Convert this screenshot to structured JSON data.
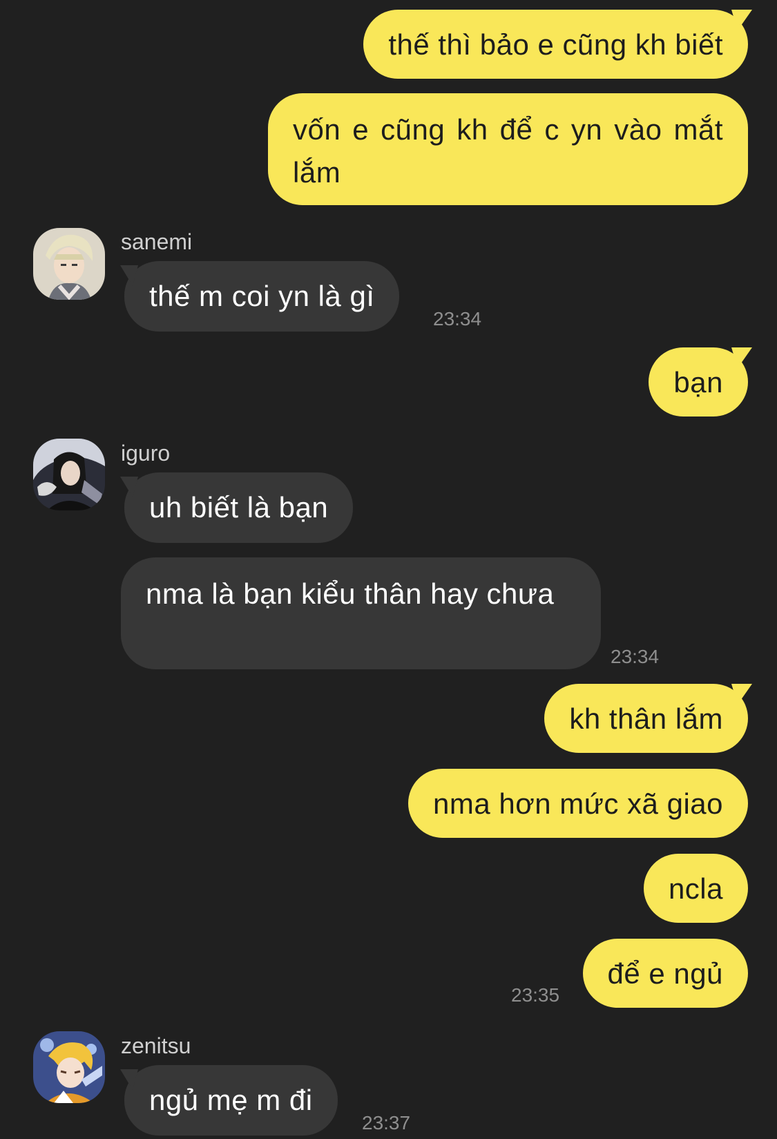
{
  "messages": [
    {
      "id": "m1",
      "direction": "outgoing",
      "text": "thế thì bảo e cũng kh biết"
    },
    {
      "id": "m2",
      "direction": "outgoing",
      "text": "vốn e cũng kh để c yn vào mắt lắm"
    },
    {
      "id": "m3",
      "direction": "incoming",
      "sender": "sanemi",
      "text": "thế m coi yn là gì",
      "time": "23:34"
    },
    {
      "id": "m4",
      "direction": "outgoing",
      "text": "bạn"
    },
    {
      "id": "m5",
      "direction": "incoming",
      "sender": "iguro",
      "text": "uh biết là bạn"
    },
    {
      "id": "m6",
      "direction": "incoming",
      "sender": "iguro",
      "text": "nma là bạn kiểu thân hay chưa",
      "time": "23:34"
    },
    {
      "id": "m7",
      "direction": "outgoing",
      "text": "kh thân lắm"
    },
    {
      "id": "m8",
      "direction": "outgoing",
      "text": "nma hơn mức xã giao"
    },
    {
      "id": "m9",
      "direction": "outgoing",
      "text": "ncla"
    },
    {
      "id": "m10",
      "direction": "outgoing",
      "text": "để e ngủ",
      "time": "23:35"
    },
    {
      "id": "m11",
      "direction": "incoming",
      "sender": "zenitsu",
      "text": "ngủ mẹ m đi",
      "time": "23:37"
    }
  ],
  "senders": {
    "sanemi": {
      "name": "sanemi",
      "avatar_icon": "anime-avatar-icon"
    },
    "iguro": {
      "name": "iguro",
      "avatar_icon": "anime-avatar-icon"
    },
    "zenitsu": {
      "name": "zenitsu",
      "avatar_icon": "anime-avatar-icon"
    }
  },
  "colors": {
    "background": "#202020",
    "outgoing_bubble": "#f9e759",
    "incoming_bubble": "#373737",
    "timestamp": "#8e8e8e"
  }
}
